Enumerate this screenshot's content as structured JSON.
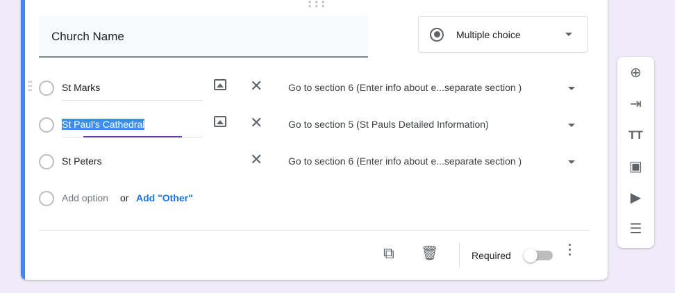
{
  "question": {
    "title": "Church Name",
    "type": "Multiple choice"
  },
  "options": [
    {
      "label": "St Marks",
      "goto": "Go to section 6 (Enter info about e...separate section )"
    },
    {
      "label": "St Paul's Cathedral",
      "goto": "Go to section 5 (St Pauls Detailed Information)"
    },
    {
      "label": "St Peters",
      "goto": "Go to section 6 (Enter info about e...separate section )"
    }
  ],
  "add_option": "Add option",
  "or": "or",
  "add_other": "Add \"Other\"",
  "footer": {
    "required_label": "Required",
    "required": false
  },
  "colors": {
    "accent": "#4285f4",
    "background": "#f0ebf8"
  }
}
